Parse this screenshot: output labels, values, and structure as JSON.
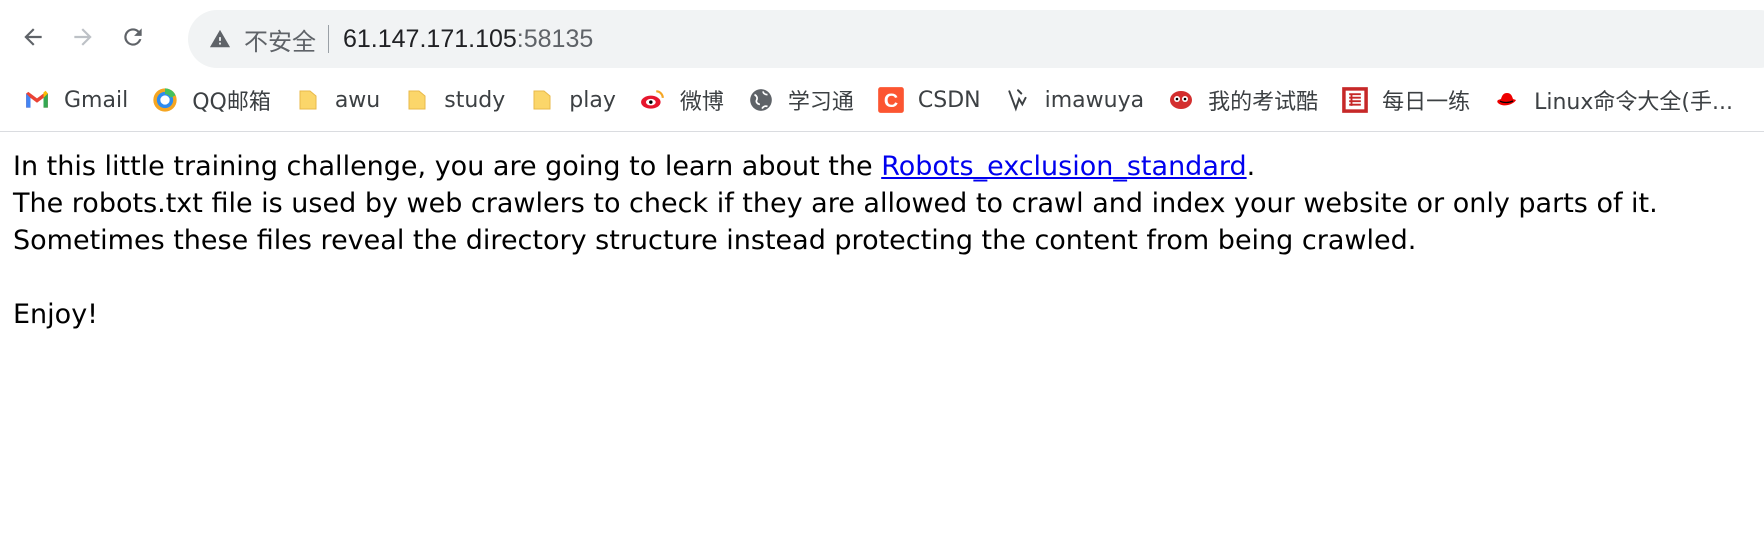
{
  "browser": {
    "security_text": "不安全",
    "url_host": "61.147.171.105",
    "url_port": ":58135"
  },
  "bookmarks": [
    {
      "label": "Gmail",
      "icon": "gmail-icon"
    },
    {
      "label": "QQ邮箱",
      "icon": "qq-mail-icon"
    },
    {
      "label": "awu",
      "icon": "folder-icon"
    },
    {
      "label": "study",
      "icon": "folder-icon"
    },
    {
      "label": "play",
      "icon": "folder-icon"
    },
    {
      "label": "微博",
      "icon": "weibo-icon"
    },
    {
      "label": "学习通",
      "icon": "globe-icon"
    },
    {
      "label": "CSDN",
      "icon": "csdn-icon"
    },
    {
      "label": "imawuya",
      "icon": "imawuya-icon"
    },
    {
      "label": "我的考试酷",
      "icon": "examcoo-icon"
    },
    {
      "label": "每日一练",
      "icon": "daily-practice-icon"
    },
    {
      "label": "Linux命令大全(手...",
      "icon": "redhat-icon"
    }
  ],
  "page": {
    "line1_prefix": "In this little training challenge, you are going to learn about the ",
    "line1_link": "Robots_exclusion_standard",
    "line1_suffix": ".",
    "line2": "The robots.txt file is used by web crawlers to check if they are allowed to crawl and index your website or only parts of it.",
    "line3": "Sometimes these files reveal the directory structure instead protecting the content from being crawled.",
    "line4": "Enjoy!"
  },
  "colors": {
    "link": "#0000ee",
    "folder": "#fbd66a",
    "csdn": "#fc5531",
    "gmail_red": "#ea4335"
  }
}
